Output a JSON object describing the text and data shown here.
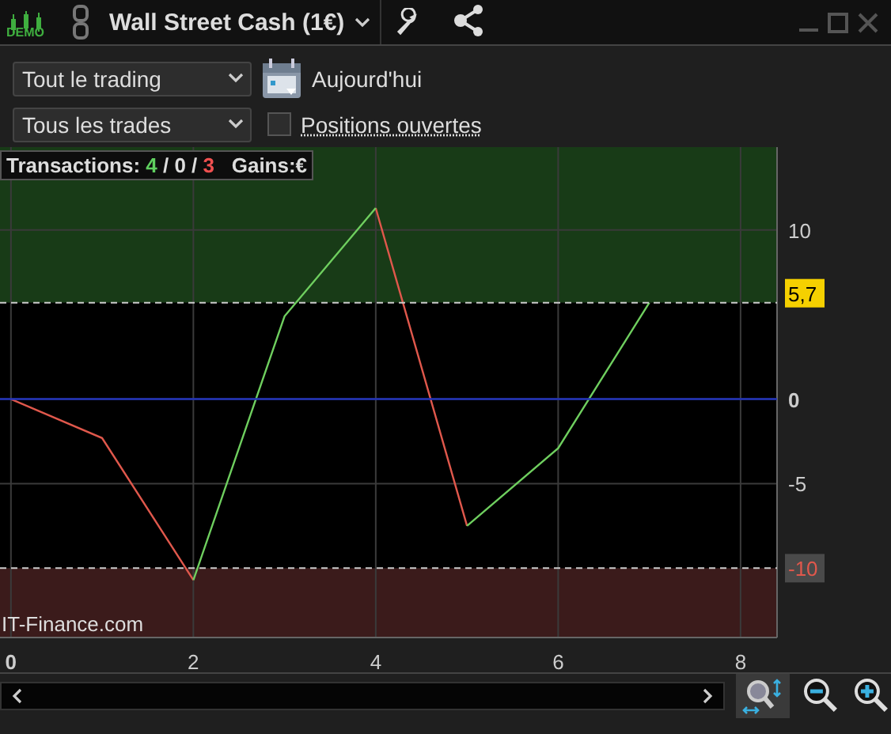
{
  "window": {
    "title": "Wall Street Cash (1€)",
    "badge": "DEMO"
  },
  "filters": {
    "scope": {
      "value": "Tout le trading"
    },
    "date": {
      "label": "Aujourd'hui"
    },
    "trades": {
      "value": "Tous les trades"
    },
    "open_positions": {
      "label": "Positions ouvertes",
      "checked": false
    }
  },
  "summary": {
    "label": "Transactions:",
    "wins": "4",
    "separator": "/",
    "neutral": "0",
    "losses": "3",
    "gains_label": "Gains:",
    "gains_value": "€"
  },
  "chart": {
    "watermark": "IT-Finance.com",
    "last_value": "5,7",
    "lower_limit": "-10",
    "chart_data": {
      "type": "line",
      "x": [
        0,
        1,
        2,
        3,
        4,
        5,
        6,
        7
      ],
      "series": [
        {
          "color": "#e0584c",
          "values": [
            0,
            -2.3,
            -10.7,
            null,
            11.3,
            -7.5,
            null,
            null
          ]
        },
        {
          "color": "#6fcf5f",
          "values": [
            null,
            null,
            -10.7,
            4.9,
            11.3,
            null,
            null,
            null
          ]
        },
        {
          "color": "#6fcf5f",
          "values": [
            null,
            null,
            null,
            null,
            null,
            -7.5,
            -2.9,
            5.7
          ]
        }
      ],
      "xlim": [
        -0.12,
        8.4
      ],
      "ylim": [
        -14.1,
        14.9
      ],
      "xticks": [
        0,
        2,
        4,
        6,
        8
      ],
      "yticks": [
        10,
        0,
        -5
      ],
      "grid": true
    }
  }
}
